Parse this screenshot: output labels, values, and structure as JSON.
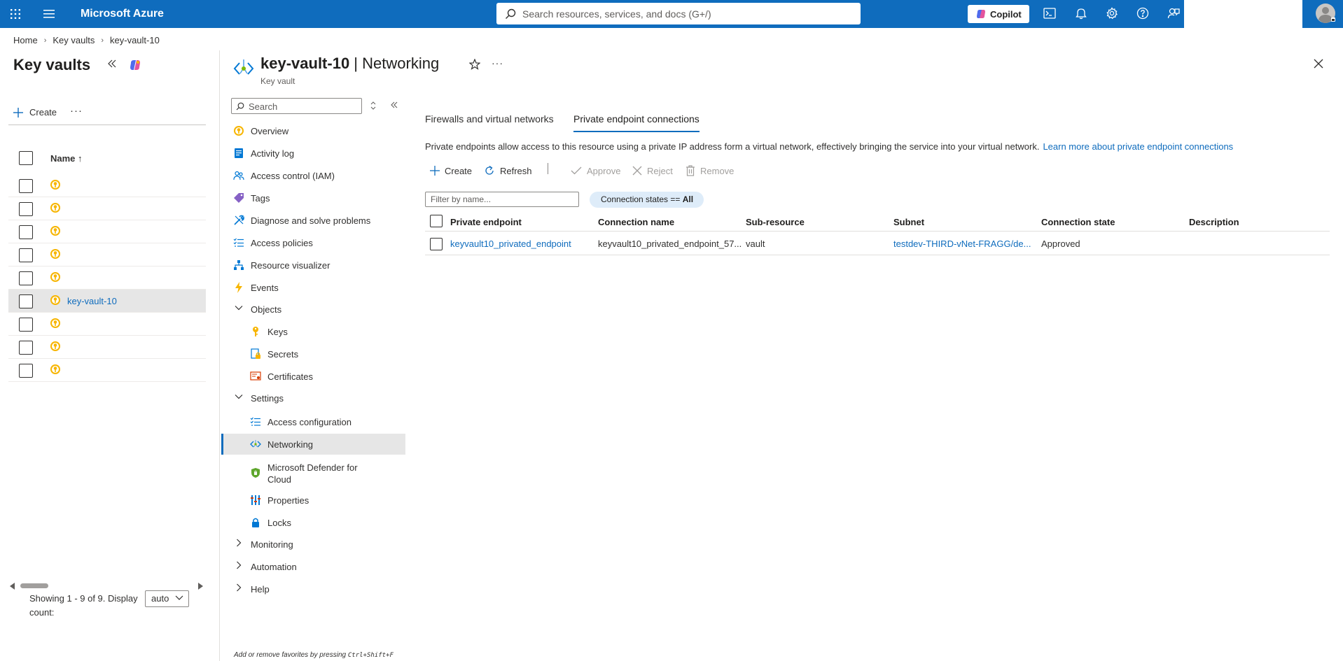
{
  "topbar": {
    "brand": "Microsoft Azure",
    "search_placeholder": "Search resources, services, and docs (G+/)",
    "copilot_label": "Copilot"
  },
  "breadcrumb": [
    "Home",
    "Key vaults",
    "key-vault-10"
  ],
  "list_panel": {
    "title": "Key vaults",
    "create_label": "Create",
    "column_name": "Name ↑",
    "rows": [
      {
        "label": "",
        "selected": false
      },
      {
        "label": "",
        "selected": false
      },
      {
        "label": "",
        "selected": false
      },
      {
        "label": "",
        "selected": false
      },
      {
        "label": "",
        "selected": false
      },
      {
        "label": "key-vault-10",
        "selected": true
      },
      {
        "label": "",
        "selected": false
      },
      {
        "label": "",
        "selected": false
      },
      {
        "label": "",
        "selected": false
      }
    ],
    "paging_text": "Showing 1 - 9 of 9. Display count:",
    "display_count": "auto"
  },
  "resource": {
    "title_name": "key-vault-10",
    "title_section": "Networking",
    "subtitle": "Key vault",
    "search_placeholder": "Search"
  },
  "menu": {
    "overview": "Overview",
    "activity_log": "Activity log",
    "iam": "Access control (IAM)",
    "tags": "Tags",
    "diagnose": "Diagnose and solve problems",
    "access_policies": "Access policies",
    "resource_visualizer": "Resource visualizer",
    "events": "Events",
    "objects": "Objects",
    "keys": "Keys",
    "secrets": "Secrets",
    "certificates": "Certificates",
    "settings": "Settings",
    "access_configuration": "Access configuration",
    "networking": "Networking",
    "defender": "Microsoft Defender for Cloud",
    "properties": "Properties",
    "locks": "Locks",
    "monitoring": "Monitoring",
    "automation": "Automation",
    "help": "Help",
    "fav_hint_prefix": "Add or remove favorites by pressing ",
    "fav_hint_keys": "Ctrl+Shift+F"
  },
  "content": {
    "tabs": [
      "Firewalls and virtual networks",
      "Private endpoint connections"
    ],
    "active_tab": 1,
    "description": "Private endpoints allow access to this resource using a private IP address form a virtual network, effectively bringing the service into your virtual network.",
    "learn_more": "Learn more about private endpoint connections",
    "commands": {
      "create": "Create",
      "refresh": "Refresh",
      "approve": "Approve",
      "reject": "Reject",
      "remove": "Remove"
    },
    "filter_placeholder": "Filter by name...",
    "pill_prefix": "Connection states == ",
    "pill_value": "All",
    "columns": [
      "Private endpoint",
      "Connection name",
      "Sub-resource",
      "Subnet",
      "Connection state",
      "Description"
    ],
    "rows": [
      {
        "private_endpoint": "keyvault10_privated_endpoint",
        "connection_name": "keyvault10_privated_endpoint_57...",
        "sub_resource": "vault",
        "subnet": "testdev-THIRD-vNet-FRAGG/de...",
        "connection_state": "Approved",
        "description": ""
      }
    ]
  },
  "colors": {
    "azure_blue": "#0f6cbd",
    "selected_row": "#e6e6e6",
    "pill_bg": "#deecf9"
  }
}
